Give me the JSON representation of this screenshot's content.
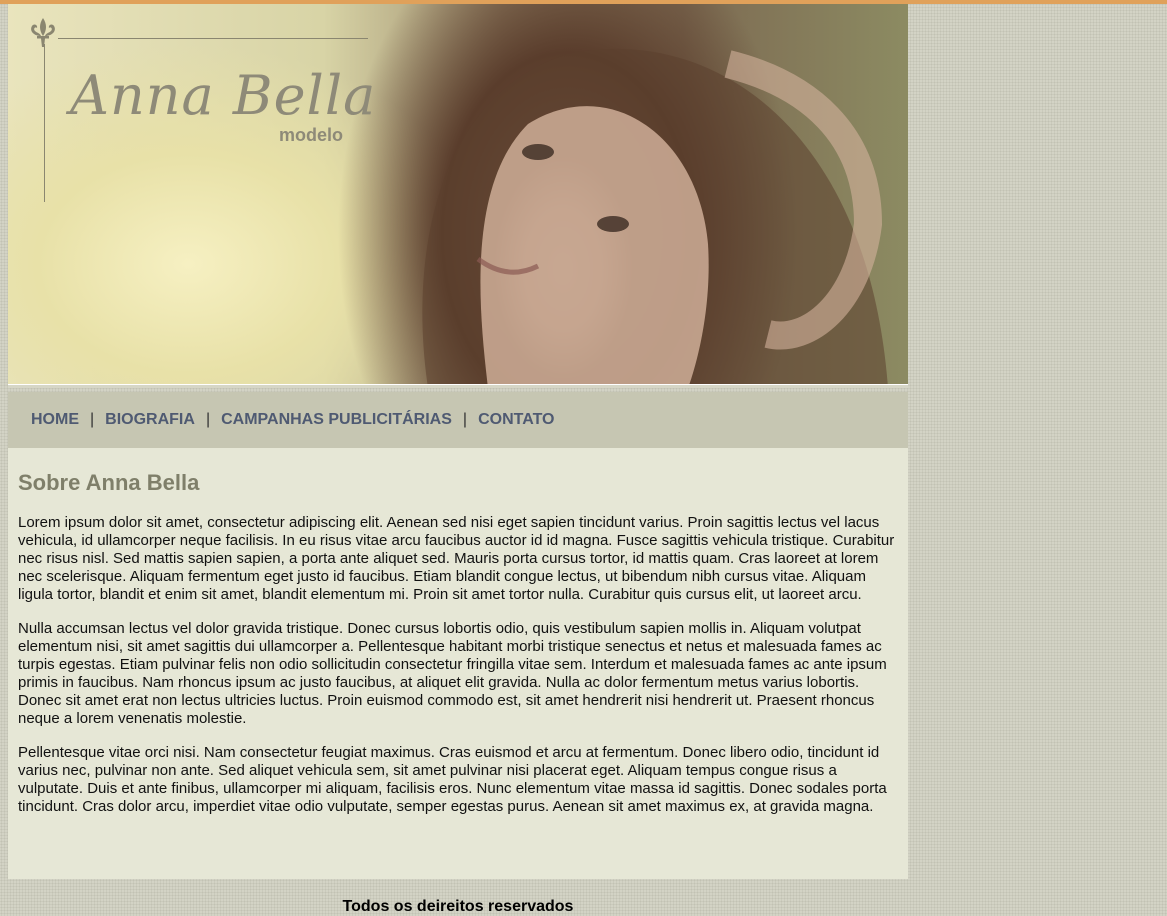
{
  "brand": {
    "name": "Anna Bella",
    "subtitle": "modelo"
  },
  "banner": {
    "icons": [
      "fleur-de-lis-icon"
    ]
  },
  "nav": {
    "items": [
      "HOME",
      "BIOGRAFIA",
      "CAMPANHAS PUBLICITÁRIAS",
      "CONTATO"
    ],
    "separator": "|"
  },
  "content": {
    "title": "Sobre Anna Bella",
    "paragraphs": [
      "Lorem ipsum dolor sit amet, consectetur adipiscing elit. Aenean sed nisi eget sapien tincidunt varius. Proin sagittis lectus vel lacus vehicula, id ullamcorper neque facilisis. In eu risus vitae arcu faucibus auctor id id magna. Fusce sagittis vehicula tristique. Curabitur nec risus nisl. Sed mattis sapien sapien, a porta ante aliquet sed. Mauris porta cursus tortor, id mattis quam. Cras laoreet at lorem nec scelerisque. Aliquam fermentum eget justo id faucibus. Etiam blandit congue lectus, ut bibendum nibh cursus vitae. Aliquam ligula tortor, blandit et enim sit amet, blandit elementum mi. Proin sit amet tortor nulla. Curabitur quis cursus elit, ut laoreet arcu.",
      "Nulla accumsan lectus vel dolor gravida tristique. Donec cursus lobortis odio, quis vestibulum sapien mollis in. Aliquam volutpat elementum nisi, sit amet sagittis dui ullamcorper a. Pellentesque habitant morbi tristique senectus et netus et malesuada fames ac turpis egestas. Etiam pulvinar felis non odio sollicitudin consectetur fringilla vitae sem. Interdum et malesuada fames ac ante ipsum primis in faucibus. Nam rhoncus ipsum ac justo faucibus, at aliquet elit gravida. Nulla ac dolor fermentum metus varius lobortis. Donec sit amet erat non lectus ultricies luctus. Proin euismod commodo est, sit amet hendrerit nisi hendrerit ut. Praesent rhoncus neque a lorem venenatis molestie.",
      "Pellentesque vitae orci nisi. Nam consectetur feugiat maximus. Cras euismod et arcu at fermentum. Donec libero odio, tincidunt id varius nec, pulvinar non ante. Sed aliquet vehicula sem, sit amet pulvinar nisi placerat eget. Aliquam tempus congue risus a vulputate. Duis et ante finibus, ullamcorper mi aliquam, facilisis eros. Nunc elementum vitae massa id sagittis. Donec sodales porta tincidunt. Cras dolor arcu, imperdiet vitae odio vulputate, semper egestas purus. Aenean sit amet maximus ex, at gravida magna."
    ]
  },
  "footer": {
    "text": "Todos os deireitos reservados"
  },
  "colors": {
    "accent_top": "#e0a15a",
    "nav_bg": "#c6c6b2",
    "nav_text": "#4f5a72",
    "content_bg": "#e6e7d6",
    "title": "#7f7f6a"
  }
}
